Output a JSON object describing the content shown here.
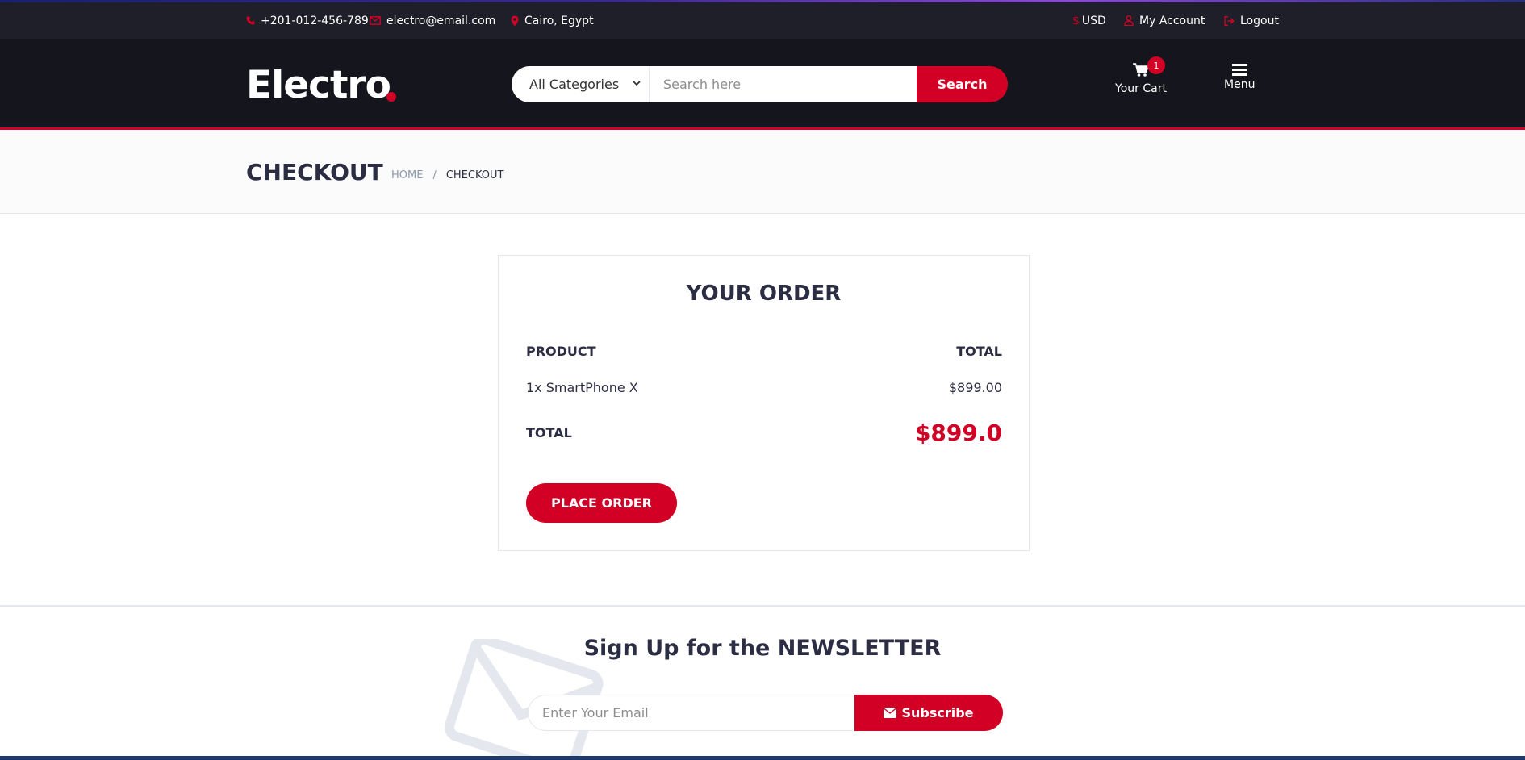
{
  "top_header": {
    "phone": "+201-012-456-789",
    "email": "electro@email.com",
    "location": "Cairo, Egypt",
    "currency_symbol": "$",
    "currency": "USD",
    "account": "My Account",
    "logout": "Logout"
  },
  "header": {
    "logo": "Electro",
    "category_selected": "All Categories",
    "search_placeholder": "Search here",
    "search_button": "Search",
    "cart_label": "Your Cart",
    "cart_qty": "1",
    "menu_label": "Menu"
  },
  "breadcrumb": {
    "title": "CHECKOUT",
    "links": [
      "HOME",
      "/",
      "CHECKOUT"
    ]
  },
  "order": {
    "title": "YOUR ORDER",
    "col_product": "PRODUCT",
    "col_total": "TOTAL",
    "item_name": "1x SmartPhone X",
    "item_price": "$899.00",
    "total_label": "TOTAL",
    "total_value": "$899.0",
    "place_order": "PLACE ORDER"
  },
  "newsletter": {
    "title_prefix": "Sign Up for the ",
    "title_bold": "NEWSLETTER",
    "email_placeholder": "Enter Your Email",
    "subscribe": "Subscribe"
  },
  "colors": {
    "accent": "#d10024",
    "dark": "#15161d",
    "top_bar": "#1e1f29",
    "text": "#2b2d42"
  }
}
